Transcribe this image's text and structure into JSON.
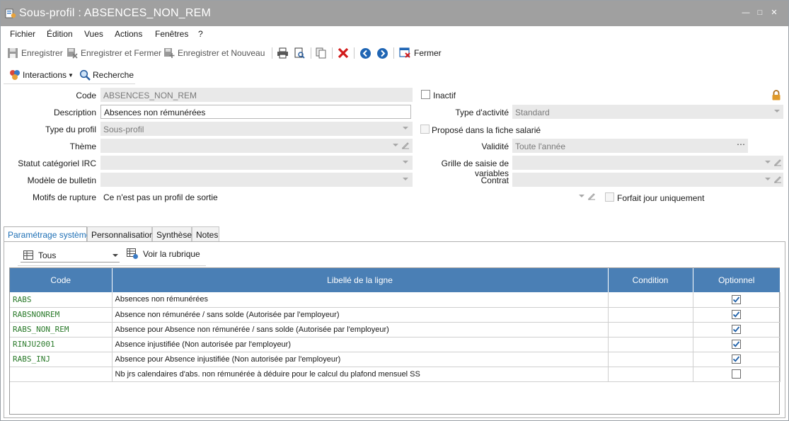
{
  "window": {
    "title": "Sous-profil : ABSENCES_NON_REM"
  },
  "menu": [
    "Fichier",
    "Édition",
    "Vues",
    "Actions",
    "Fenêtres",
    "?"
  ],
  "toolbar": {
    "save": "Enregistrer",
    "save_close": "Enregistrer et Fermer",
    "save_new": "Enregistrer et Nouveau",
    "close": "Fermer"
  },
  "subbar": {
    "interactions": "Interactions",
    "search": "Recherche"
  },
  "form": {
    "code": {
      "label": "Code",
      "value": "ABSENCES_NON_REM"
    },
    "inactif": {
      "label": "Inactif",
      "checked": false
    },
    "description": {
      "label": "Description",
      "value": "Absences non rémunérées"
    },
    "type_activite": {
      "label": "Type d'activité",
      "value": "Standard"
    },
    "type_profil": {
      "label": "Type du profil",
      "value": "Sous-profil"
    },
    "propose": {
      "label": "Proposé dans la fiche salarié",
      "checked": false
    },
    "theme": {
      "label": "Thème",
      "value": ""
    },
    "validite": {
      "label": "Validité",
      "value": "Toute l'année"
    },
    "statut_irc": {
      "label": "Statut catégoriel IRC",
      "value": ""
    },
    "grille": {
      "label": "Grille de saisie de variables",
      "value": ""
    },
    "modele": {
      "label": "Modèle de bulletin",
      "value": ""
    },
    "contrat": {
      "label": "Contrat",
      "value": ""
    },
    "motifs": {
      "label": "Motifs de rupture",
      "value": "Ce n'est pas un profil de sortie"
    },
    "forfait": {
      "label": "Forfait jour uniquement",
      "checked": false
    }
  },
  "tabs": [
    "Paramétrage système",
    "Personnalisation",
    "Synthèse",
    "Notes"
  ],
  "grid_toolbar": {
    "filter": "Tous",
    "view_button": "Voir la rubrique"
  },
  "table": {
    "columns": [
      "Code",
      "Libellé de la ligne",
      "Condition",
      "Optionnel"
    ],
    "rows": [
      {
        "code": "RABS",
        "label": "Absences non rémunérées",
        "condition": "",
        "optional": true
      },
      {
        "code": "RABSNONREM",
        "label": "Absence non rémunérée / sans solde (Autorisée par l'employeur)",
        "condition": "",
        "optional": true
      },
      {
        "code": "RABS_NON_REM",
        "label": "Absence pour Absence non rémunérée / sans solde (Autorisée par l'employeur)",
        "condition": "",
        "optional": true
      },
      {
        "code": "RINJU2001",
        "label": "Absence injustifiée (Non autorisée par l'employeur)",
        "condition": "",
        "optional": true
      },
      {
        "code": "RABS_INJ",
        "label": "Absence pour Absence injustifiée (Non autorisée par l'employeur)",
        "condition": "",
        "optional": true
      },
      {
        "code": "",
        "label": "Nb jrs calendaires d'abs. non rémunérée à déduire pour le calcul du plafond mensuel SS",
        "condition": "",
        "optional": false
      }
    ]
  },
  "colors": {
    "header_blue": "#4a7fb5",
    "code_green": "#2a7a2a",
    "titlebar": "#a0a0a0",
    "active_tab": "#1d6fb5"
  }
}
